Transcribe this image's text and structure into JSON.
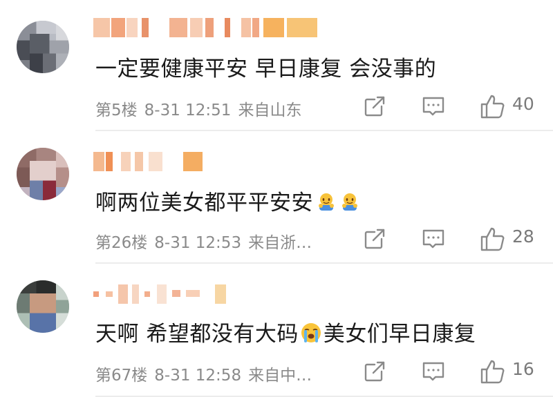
{
  "comments": [
    {
      "text": "一定要健康平安 早日康复 会没事的",
      "floor": "第5楼",
      "datetime": "8-31 12:51",
      "location": "来自山东",
      "likes": "40"
    },
    {
      "text": "啊两位美女都平平安安",
      "floor": "第26楼",
      "datetime": "8-31 12:53",
      "location": "来自浙…",
      "likes": "28",
      "emojis": [
        "hug-emoji",
        "hug-emoji"
      ]
    },
    {
      "text_before": "天啊 希望都没有大码",
      "text_after": "美女们早日康复",
      "floor": "第67楼",
      "datetime": "8-31 12:58",
      "location": "来自中…",
      "likes": "16",
      "emojis": [
        "crying-emoji"
      ]
    }
  ],
  "icons": {
    "share": "share-icon",
    "reply": "reply-icon",
    "like": "thumbs-up-icon"
  },
  "colors": {
    "text": "#1a1a1a",
    "meta": "#8a8a8a",
    "icon": "#8a8a8a",
    "divider": "#ececec"
  }
}
